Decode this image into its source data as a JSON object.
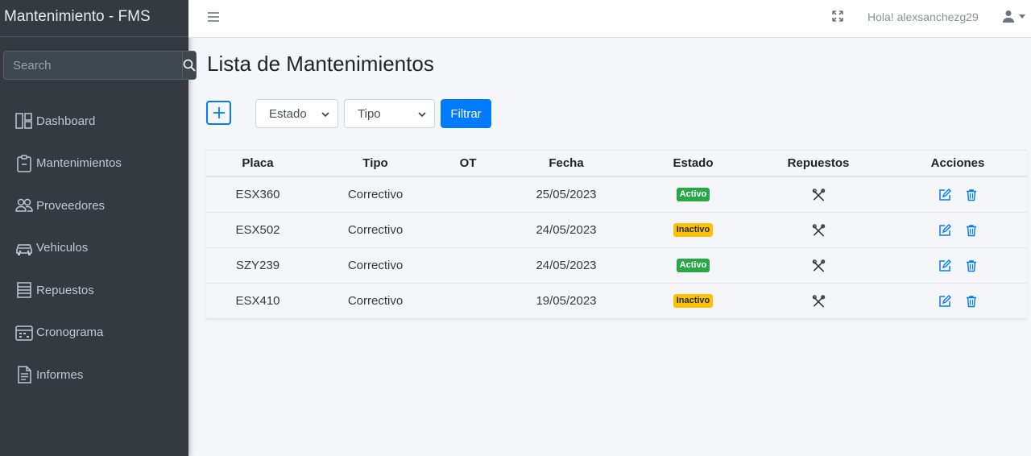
{
  "sidebar": {
    "brand": "Mantenimiento - FMS",
    "search": {
      "placeholder": "Search"
    },
    "items": [
      {
        "label": "Dashboard",
        "icon": "dashboard-icon"
      },
      {
        "label": "Mantenimientos",
        "icon": "clipboard-icon"
      },
      {
        "label": "Proveedores",
        "icon": "people-icon"
      },
      {
        "label": "Vehiculos",
        "icon": "car-icon"
      },
      {
        "label": "Repuestos",
        "icon": "list-icon"
      },
      {
        "label": "Cronograma",
        "icon": "calendar-icon"
      },
      {
        "label": "Informes",
        "icon": "document-icon"
      }
    ]
  },
  "topbar": {
    "greeting": "Hola! alexsanchezg29"
  },
  "main": {
    "title": "Lista de Mantenimientos",
    "filters": {
      "estado": "Estado",
      "tipo": "Tipo",
      "filter_label": "Filtrar"
    },
    "table": {
      "headers": [
        "Placa",
        "Tipo",
        "OT",
        "Fecha",
        "Estado",
        "Repuestos",
        "Acciones"
      ],
      "rows": [
        {
          "placa": "ESX360",
          "tipo": "Correctivo",
          "ot": "",
          "fecha": "25/05/2023",
          "estado": "Activo"
        },
        {
          "placa": "ESX502",
          "tipo": "Correctivo",
          "ot": "",
          "fecha": "24/05/2023",
          "estado": "Inactivo"
        },
        {
          "placa": "SZY239",
          "tipo": "Correctivo",
          "ot": "",
          "fecha": "24/05/2023",
          "estado": "Activo"
        },
        {
          "placa": "ESX410",
          "tipo": "Correctivo",
          "ot": "",
          "fecha": "19/05/2023",
          "estado": "Inactivo"
        }
      ]
    }
  },
  "colors": {
    "sidebar_bg": "#343a40",
    "primary": "#007bff",
    "success": "#28a745",
    "warning": "#ffc107"
  }
}
